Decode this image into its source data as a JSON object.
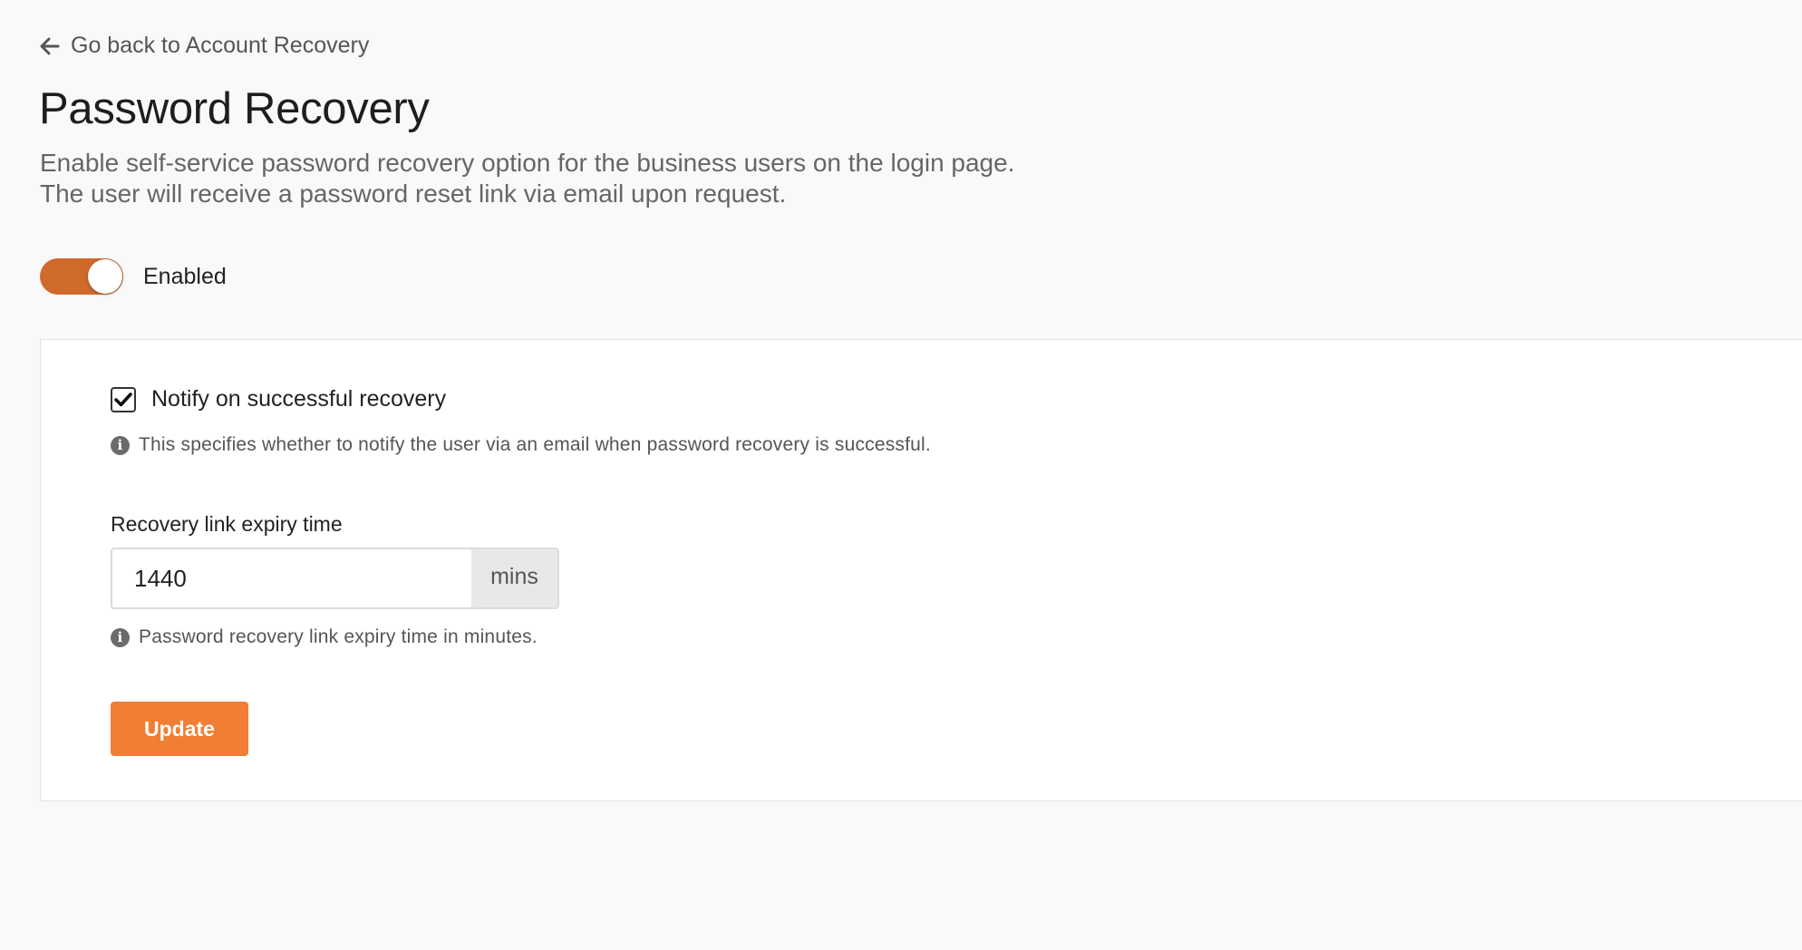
{
  "back_link": {
    "label": "Go back to Account Recovery",
    "icon": "arrow-left-icon"
  },
  "page": {
    "title": "Password Recovery",
    "description_line1": "Enable self-service password recovery option for the business users on the login page.",
    "description_line2": "The user will receive a password reset link via email upon request."
  },
  "toggle": {
    "label": "Enabled",
    "checked": true,
    "color": "#cf6a2c"
  },
  "notify": {
    "label": "Notify on successful recovery",
    "checked": true,
    "help": "This specifies whether to notify the user via an email when password recovery is successful.",
    "help_icon": "info-icon"
  },
  "expiry": {
    "label": "Recovery link expiry time",
    "value": "1440",
    "unit": "mins",
    "help": "Password recovery link expiry time in minutes.",
    "help_icon": "info-icon"
  },
  "update_button": {
    "label": "Update",
    "color": "#f07f34"
  }
}
